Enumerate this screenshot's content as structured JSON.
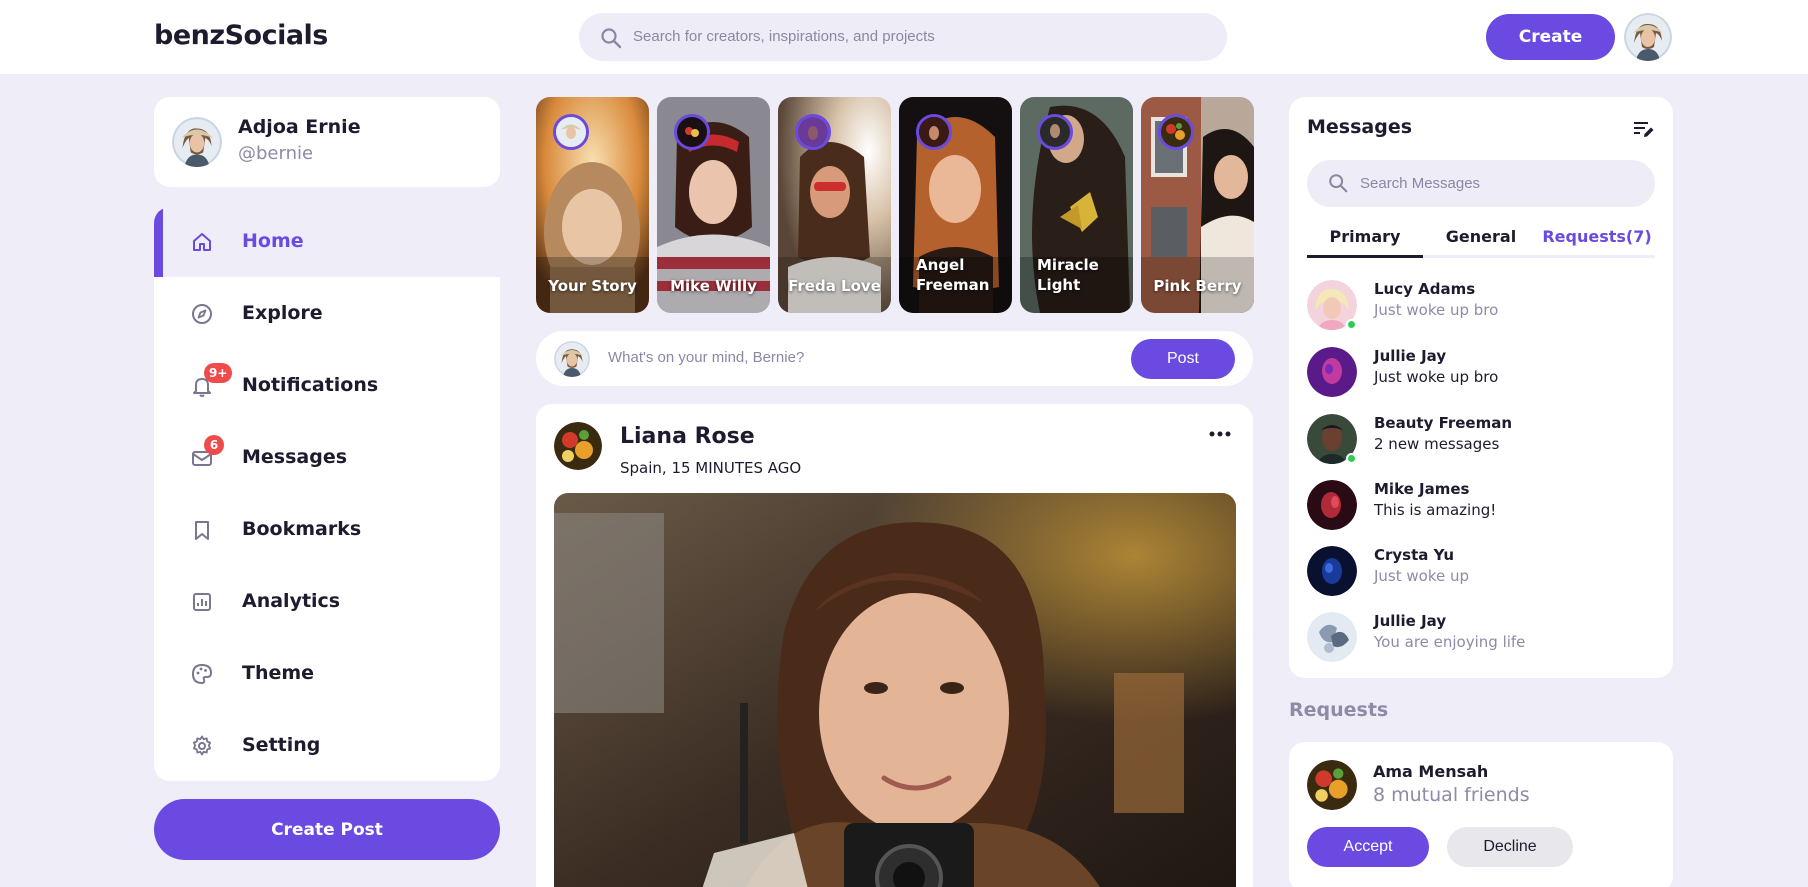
{
  "brand": "benzSocials",
  "search": {
    "placeholder": "Search for creators, inspirations, and projects"
  },
  "header": {
    "create_label": "Create"
  },
  "profile": {
    "name": "Adjoa Ernie",
    "handle": "@bernie"
  },
  "sidebar": {
    "items": [
      {
        "label": "Home",
        "icon": "home-icon",
        "active": true
      },
      {
        "label": "Explore",
        "icon": "compass-icon"
      },
      {
        "label": "Notifications",
        "icon": "bell-icon",
        "badge": "9+"
      },
      {
        "label": "Messages",
        "icon": "mail-icon",
        "badge": "6"
      },
      {
        "label": "Bookmarks",
        "icon": "bookmark-icon"
      },
      {
        "label": "Analytics",
        "icon": "chart-icon"
      },
      {
        "label": "Theme",
        "icon": "palette-icon"
      },
      {
        "label": "Setting",
        "icon": "gear-icon"
      }
    ],
    "create_post_label": "Create Post"
  },
  "stories": [
    {
      "name": "Your Story"
    },
    {
      "name": "Mike Willy"
    },
    {
      "name": "Freda Love"
    },
    {
      "name": "Angel Freeman"
    },
    {
      "name": "Miracle Light"
    },
    {
      "name": "Pink Berry"
    }
  ],
  "composer": {
    "placeholder": "What's on your mind, Bernie?",
    "post_label": "Post"
  },
  "feed": [
    {
      "author": "Liana Rose",
      "meta": "Spain, 15 MINUTES AGO"
    }
  ],
  "messages": {
    "title": "Messages",
    "search_placeholder": "Search Messages",
    "tabs": [
      "Primary",
      "General",
      "Requests(7)"
    ],
    "items": [
      {
        "name": "Lucy Adams",
        "text": "Just woke up bro",
        "online": true,
        "muted": true
      },
      {
        "name": "Jullie Jay",
        "text": "Just woke up bro",
        "online": false,
        "muted": false
      },
      {
        "name": "Beauty Freeman",
        "text": "2 new messages",
        "online": true,
        "muted": false
      },
      {
        "name": "Mike James",
        "text": "This is amazing!",
        "online": false,
        "muted": false
      },
      {
        "name": "Crysta Yu",
        "text": "Just woke up",
        "online": false,
        "muted": true
      },
      {
        "name": "Jullie Jay",
        "text": "You are enjoying life",
        "online": false,
        "muted": true
      }
    ]
  },
  "requests": {
    "title": "Requests",
    "items": [
      {
        "name": "Ama Mensah",
        "sub": "8 mutual friends",
        "accept_label": "Accept",
        "decline_label": "Decline"
      }
    ]
  },
  "colors": {
    "accent": "#6a4ae0",
    "background": "#efedf8",
    "badge": "#ef4b4b",
    "online": "#2ecc55"
  }
}
